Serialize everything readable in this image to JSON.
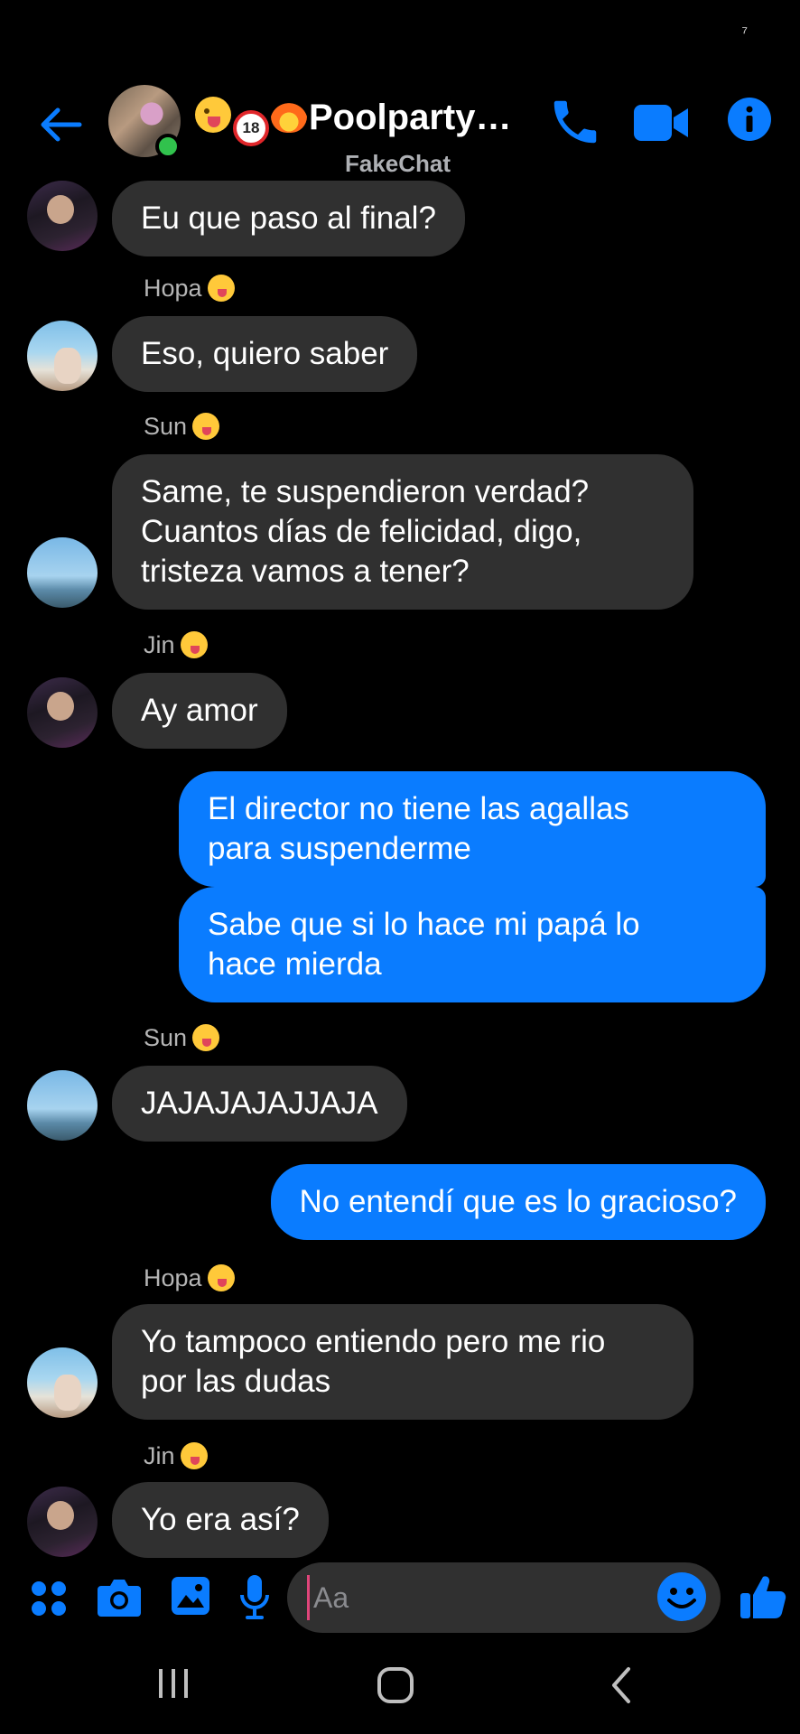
{
  "status_bar": {
    "glyph": "⁷"
  },
  "header": {
    "title": "Poolparty…",
    "subtitle": "FakeChat",
    "title_icons": [
      "wink-tongue-emoji",
      "no-under-18-emoji",
      "fire-emoji"
    ]
  },
  "colors": {
    "accent": "#0a7cff",
    "incoming_bubble": "#303030",
    "background": "#000000",
    "online": "#31c24d"
  },
  "messages": [
    {
      "side": "in",
      "avatar": "jin",
      "lines": [
        "Eu que paso al final?"
      ]
    },
    {
      "sender": "Hopa",
      "side": "in",
      "avatar": "hopa",
      "lines": [
        "Eso, quiero saber"
      ]
    },
    {
      "sender": "Sun",
      "side": "in",
      "avatar": "sun",
      "lines": [
        "Same, te suspendieron verdad?",
        "Cuantos días de felicidad, digo,",
        "tristeza vamos a tener?"
      ]
    },
    {
      "sender": "Jin",
      "side": "in",
      "avatar": "jin",
      "lines": [
        "Ay amor"
      ]
    },
    {
      "side": "out",
      "lines": [
        "El director no tiene las agallas",
        "para suspenderme"
      ]
    },
    {
      "side": "out",
      "lines": [
        "Sabe que si lo hace mi papá lo",
        "hace mierda"
      ]
    },
    {
      "sender": "Sun",
      "side": "in",
      "avatar": "sun",
      "lines": [
        "JAJAJAJAJJAJA"
      ]
    },
    {
      "side": "out",
      "lines": [
        "No entendí que es lo gracioso?"
      ]
    },
    {
      "sender": "Hopa",
      "side": "in",
      "avatar": "hopa",
      "lines": [
        "Yo tampoco entiendo pero me rio",
        "por las dudas"
      ]
    },
    {
      "sender": "Jin",
      "side": "in",
      "avatar": "jin",
      "lines": [
        "Yo era así?"
      ]
    }
  ],
  "composer": {
    "placeholder": "Aa",
    "icons": [
      "apps-icon",
      "camera-icon",
      "gallery-icon",
      "microphone-icon",
      "emoji-icon",
      "like-icon"
    ]
  },
  "nav_bar": {
    "icons": [
      "recent-apps-icon",
      "home-icon",
      "back-icon"
    ]
  }
}
